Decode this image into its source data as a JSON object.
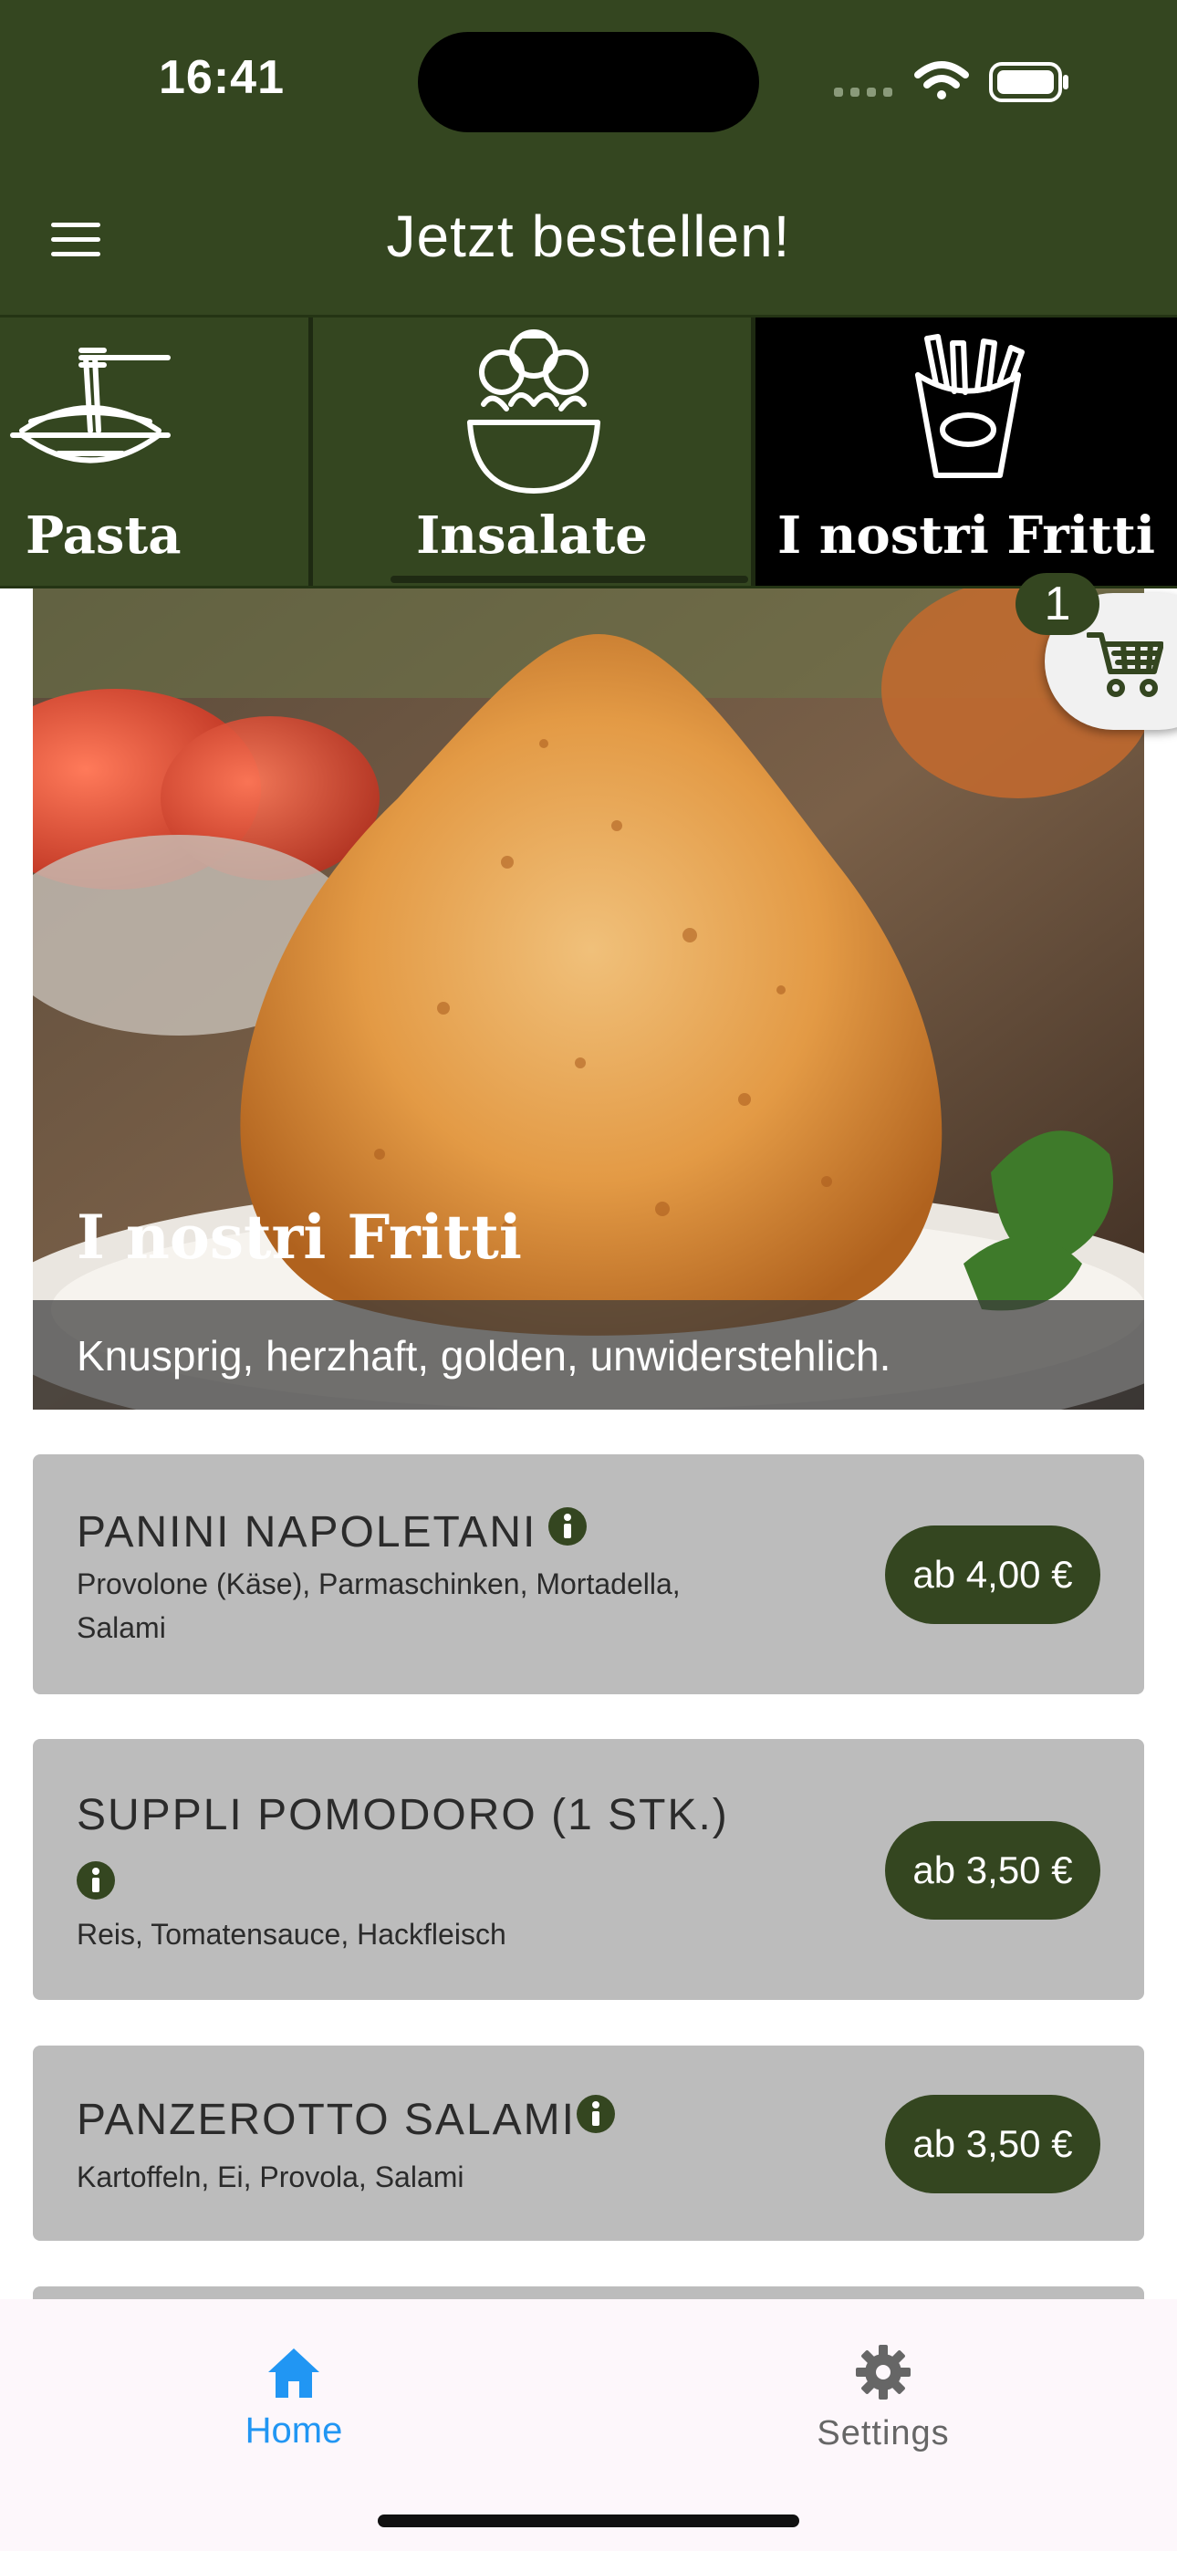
{
  "status_bar": {
    "time": "16:41"
  },
  "header": {
    "title": "Jetzt bestellen!"
  },
  "categories": [
    {
      "label": "Pasta",
      "icon": "pasta-icon"
    },
    {
      "label": "Insalate",
      "icon": "salad-icon"
    },
    {
      "label": "I nostri Fritti",
      "icon": "fries-icon",
      "selected": true
    }
  ],
  "cart": {
    "count": "1"
  },
  "hero": {
    "title": "I nostri Fritti",
    "subtitle": "Knusprig, herzhaft, golden, unwiderstehlich."
  },
  "products": [
    {
      "name": "PANINI NAPOLETANI",
      "description": "Provolone (Käse), Parmaschinken, Mortadella, Salami",
      "price": "ab 4,00 €"
    },
    {
      "name": "SUPPLI POMODORO (1 STK.)",
      "description": "Reis, Tomatensauce, Hackfleisch",
      "price": "ab 3,50 €"
    },
    {
      "name": "PANZEROTTO SALAMI",
      "description": "Kartoffeln, Ei, Provola, Salami",
      "price": "ab 3,50 €"
    }
  ],
  "bottom_nav": [
    {
      "label": "Home",
      "icon": "home-icon",
      "active": true
    },
    {
      "label": "Settings",
      "icon": "gear-icon",
      "active": false
    }
  ],
  "colors": {
    "brand_green": "#344620",
    "card_gray": "#bcbcbc",
    "nav_active": "#2196f3",
    "nav_inactive": "#666666"
  }
}
